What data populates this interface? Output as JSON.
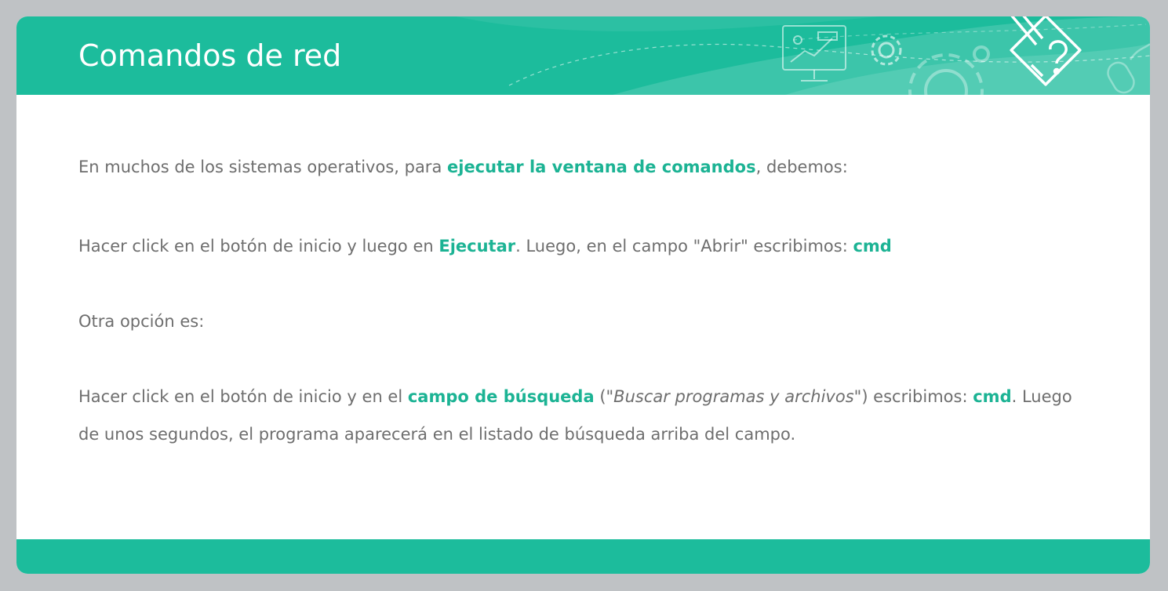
{
  "title": "Comandos de red",
  "paragraphs": {
    "p1": {
      "t1": "En muchos de los sistemas operativos, para ",
      "b1": "ejecutar la ventana de comandos",
      "t2": ", debemos:"
    },
    "p2": {
      "t1": "Hacer click en el botón de inicio y luego en ",
      "b1": "Ejecutar",
      "t2": ". Luego, en el campo \"Abrir\" escribimos: ",
      "b2": "cmd"
    },
    "p3": {
      "t1": "Otra opción es:"
    },
    "p4": {
      "t1": "Hacer click en el botón de inicio y en el ",
      "b1": "campo de búsqueda",
      "t2": " (\"",
      "i1": "Buscar programas y archivos",
      "t3": "\") escribimos: ",
      "b2": "cmd",
      "t4": ". Luego de unos segundos, el programa aparecerá en el listado de búsqueda arriba del campo."
    }
  },
  "colors": {
    "accent": "#1cbc9c",
    "highlight_text": "#1cb394",
    "body_text": "#6e6e6e",
    "background": "#bfc2c5"
  },
  "icons": [
    "monitor-chart-icon",
    "gear-icon",
    "large-gear-icon",
    "pencil-puzzle-icon",
    "mouse-icon"
  ]
}
